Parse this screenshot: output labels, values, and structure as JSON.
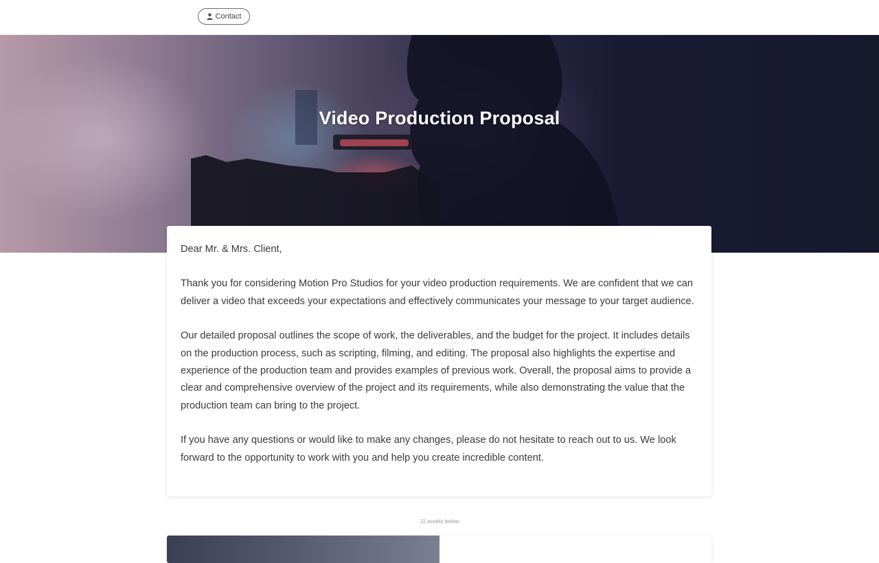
{
  "header": {
    "contact_label": "Contact",
    "contact_icon": "user-icon"
  },
  "hero": {
    "title": "Video Production Proposal"
  },
  "letter": {
    "greeting": "Dear Mr. & Mrs. Client,",
    "paragraph_1": "Thank you for considering Motion Pro Studios for your video production requirements. We are confident that we can deliver a video that exceeds your expectations and effectively communicates your message to your target audience.",
    "paragraph_2": "Our detailed proposal outlines the scope of work, the deliverables, and the budget for the project. It includes details on the production process, such as scripting, filming, and editing. The proposal also highlights the expertise and experience of the production team and provides examples of previous work. Overall, the proposal aims to provide a clear and comprehensive overview of the project and its requirements, while also demonstrating the value that the production team can bring to the project.",
    "paragraph_3": "If you have any questions or would like to make any changes, please do not hesitate to reach out to us. We look forward to the opportunity to work with you and help you create incredible content."
  },
  "assets": {
    "note": "11 assets below"
  }
}
